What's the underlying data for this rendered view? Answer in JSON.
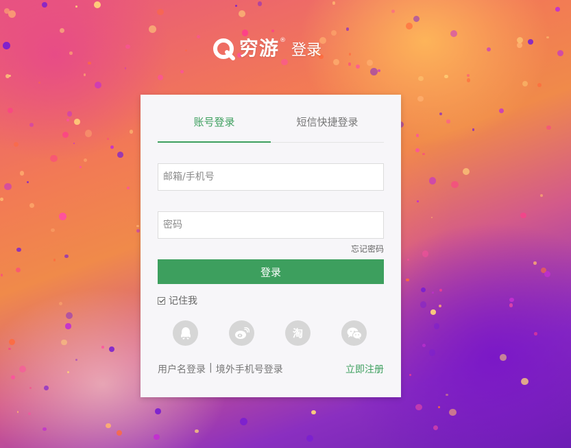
{
  "header": {
    "brand": "穷游",
    "registered_mark": "®",
    "subtitle": "登录"
  },
  "tabs": [
    {
      "label": "账号登录",
      "active": true
    },
    {
      "label": "短信快捷登录",
      "active": false
    }
  ],
  "form": {
    "username_placeholder": "邮箱/手机号",
    "username_value": "",
    "password_placeholder": "密码",
    "password_value": "",
    "forgot_password": "忘记密码",
    "submit_label": "登录",
    "remember_me": "记住我",
    "remember_checked": true
  },
  "social_login": [
    {
      "icon": "qq-icon"
    },
    {
      "icon": "weibo-icon"
    },
    {
      "icon": "taobao-icon",
      "glyph": "淘"
    },
    {
      "icon": "wechat-icon"
    }
  ],
  "footer": {
    "username_login": "用户名登录",
    "separator": "|",
    "overseas_login": "境外手机号登录",
    "register": "立即注册"
  },
  "colors": {
    "accent": "#3d9f5e",
    "card_background": "#f7f6f9",
    "social_icon_bg": "#d6d6d6"
  }
}
